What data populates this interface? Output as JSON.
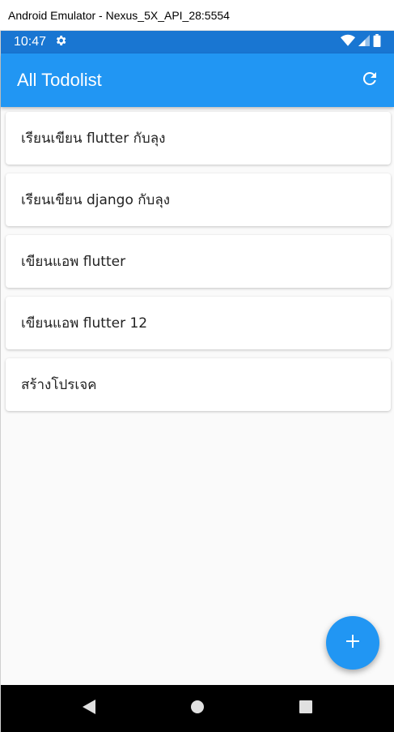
{
  "window": {
    "title": "Android Emulator - Nexus_5X_API_28:5554"
  },
  "status_bar": {
    "time": "10:47",
    "background": "#1976d2"
  },
  "app_bar": {
    "title": "All Todolist",
    "background": "#2196f3",
    "action_icon": "refresh-icon"
  },
  "todos": [
    {
      "title": "เรียนเขียน flutter กับลุง"
    },
    {
      "title": "เรียนเขียน django กับลุง"
    },
    {
      "title": "เขียนแอพ flutter"
    },
    {
      "title": "เขียนแอพ flutter 12"
    },
    {
      "title": "สร้างโปรเจค"
    }
  ],
  "fab": {
    "icon": "plus-icon",
    "background": "#2196f3"
  },
  "nav_bar": {
    "buttons": [
      "back-icon",
      "home-icon",
      "recents-icon"
    ]
  }
}
